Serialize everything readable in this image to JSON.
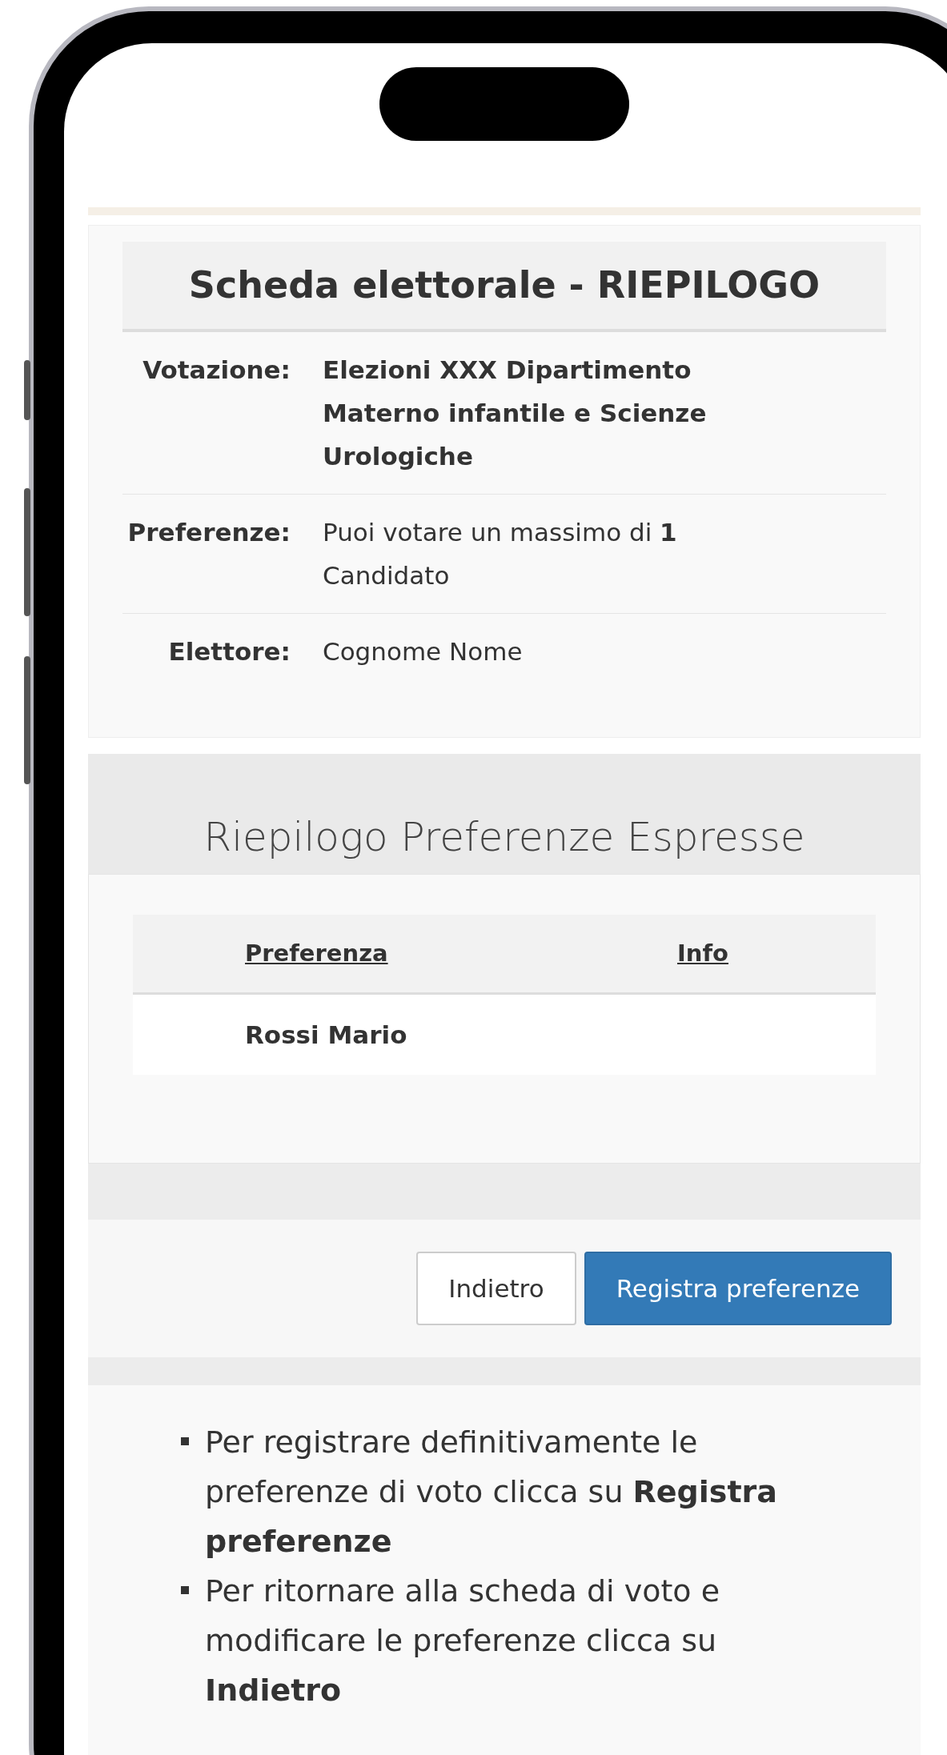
{
  "ballot": {
    "title": "Scheda elettorale - RIEPILOGO",
    "fields": [
      {
        "label": "Votazione:",
        "value": "Elezioni XXX Dipartimento Materno infantile e Scienze Urologiche",
        "emphasis": true
      },
      {
        "label": "Preferenze:",
        "value": "Puoi votare un massimo di **1** Candidato",
        "emphasis": false
      },
      {
        "label": "Elettore:",
        "value": "Cognome Nome",
        "emphasis": false
      }
    ]
  },
  "summary": {
    "heading": "Riepilogo Preferenze Espresse",
    "columns": [
      "Preferenza",
      "Info"
    ],
    "rows": [
      {
        "cells": [
          "Rossi Mario"
        ]
      }
    ]
  },
  "buttons": [
    {
      "label": "Indietro",
      "kind": "secondary"
    },
    {
      "label": "Registra preferenze",
      "kind": "primary"
    }
  ],
  "instructions": [
    "Per registrare definitivamente le preferenze di voto clicca su **Registra preferenze**",
    "Per ritornare alla scheda di voto e modificare le preferenze clicca su **Indietro**"
  ]
}
